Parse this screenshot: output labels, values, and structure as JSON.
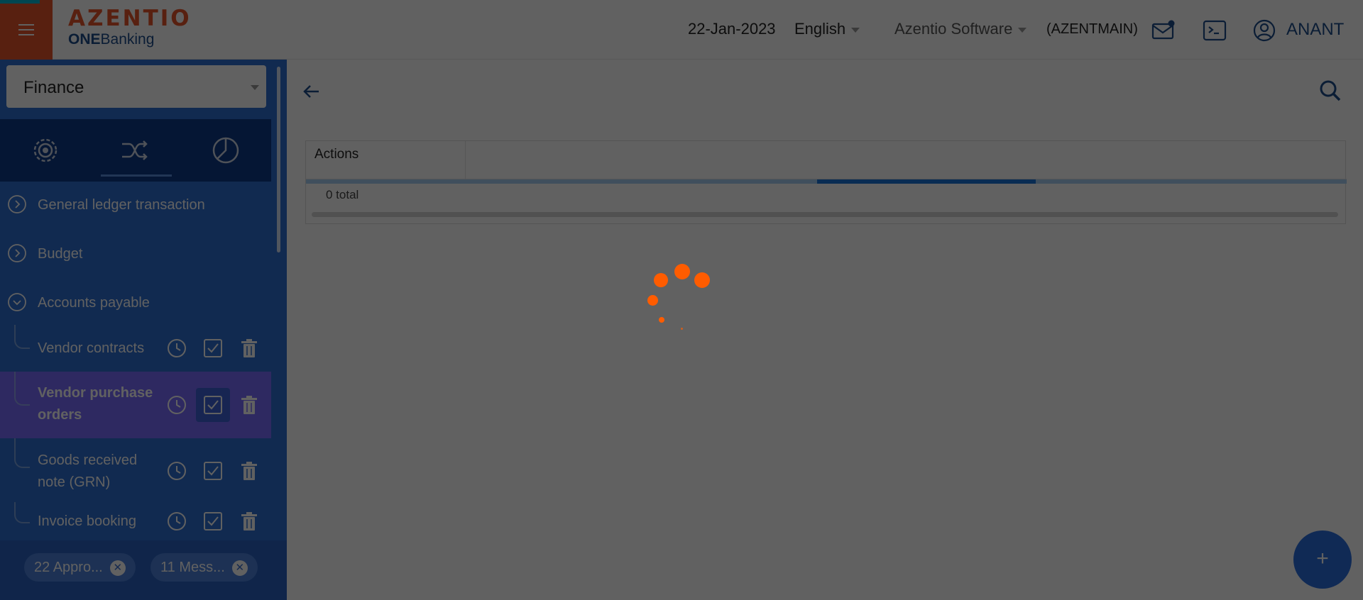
{
  "header": {
    "brand": "AZENTIO",
    "product_bold": "ONE",
    "product_rest": "Banking",
    "date": "22-Jan-2023",
    "language": "English",
    "company": "Azentio Software",
    "branch": "(AZENTMAIN)",
    "user": "ANANT"
  },
  "sidebar": {
    "module": "Finance",
    "menu": [
      {
        "label": "General ledger transaction"
      },
      {
        "label": "Budget"
      },
      {
        "label": "Accounts payable"
      }
    ],
    "sub_items": [
      {
        "label_line1": "Vendor contracts",
        "label_line2": ""
      },
      {
        "label_line1": "Vendor purchase",
        "label_line2": "orders"
      },
      {
        "label_line1": "Goods received",
        "label_line2": "note (GRN)"
      },
      {
        "label_line1": "Invoice booking",
        "label_line2": ""
      }
    ],
    "pills": [
      {
        "label": "22 Appro..."
      },
      {
        "label": "11 Mess..."
      }
    ]
  },
  "main": {
    "grid": {
      "column": "Actions",
      "total": "0 total",
      "loading_fraction": 0.21
    },
    "fab_label": "+"
  },
  "colors": {
    "accent": "#e8552a",
    "sidebar": "#2f6fd2",
    "spinner": "#ff5c00"
  }
}
